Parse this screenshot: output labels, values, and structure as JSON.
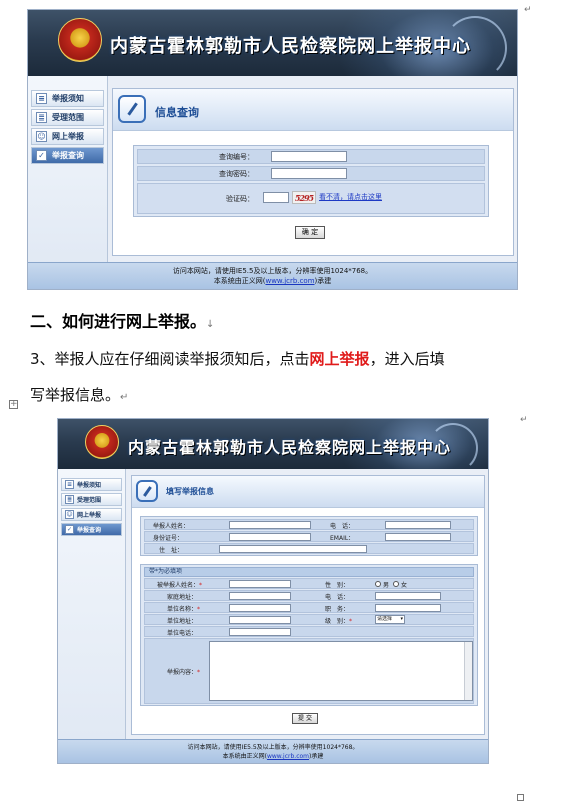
{
  "doc": {
    "section_heading": "二、如何进行网上举报。",
    "para_lead": "3、举报人应在仔细阅读举报须知后，点击",
    "para_highlight": "网上举报",
    "para_tail": "，进入后填",
    "para_line2": "写举报信息。",
    "return_mark": "↵",
    "down_mark": "↓"
  },
  "shot1": {
    "banner_title": "内蒙古霍林郭勒市人民检察院网上举报中心",
    "nav": [
      {
        "label": "举报须知",
        "icon": "document-icon",
        "glyph": "≡"
      },
      {
        "label": "受理范围",
        "icon": "list-icon",
        "glyph": "≣"
      },
      {
        "label": "网上举报",
        "icon": "person-card-icon",
        "glyph": "☺"
      },
      {
        "label": "举报查询",
        "icon": "checklist-icon",
        "glyph": "✓"
      }
    ],
    "panel_title": "信息查询",
    "fields": {
      "query_no_label": "查询编号：",
      "query_pwd_label": "查询密码：",
      "captcha_label": "验证码："
    },
    "captcha_text": "5295",
    "captcha_link": "看不清，请点击这里",
    "submit_label": "确 定",
    "footer_line1": "访问本网站，请使用IE5.5及以上版本，分辨率使用1024*768。",
    "footer_line2_pre": "本系统由正义网(",
    "footer_url": "www.jcrb.com",
    "footer_line2_post": ")承建"
  },
  "shot2": {
    "banner_title": "内蒙古霍林郭勒市人民检察院网上举报中心",
    "nav": [
      {
        "label": "举报须知",
        "icon": "document-icon",
        "glyph": "≡"
      },
      {
        "label": "受理范围",
        "icon": "list-icon",
        "glyph": "≣"
      },
      {
        "label": "网上举报",
        "icon": "person-card-icon",
        "glyph": "☺"
      },
      {
        "label": "举报查询",
        "icon": "checklist-icon",
        "glyph": "✓"
      }
    ],
    "panel_title": "填写举报信息",
    "reporter": {
      "name_label": "举报人姓名：",
      "phone_label": "电　话：",
      "id_label": "身份证号：",
      "email_label": "EMAIL：",
      "address_label": "住　址："
    },
    "fieldset_title": "带*为必填项",
    "reported": {
      "name_label": "被举报人姓名：",
      "gender_label": "性　别：",
      "gender_male": "男",
      "gender_female": "女",
      "home_addr_label": "家庭地址：",
      "phone_label": "电　话：",
      "unit_name_label": "单位名称：",
      "job_label": "职　务：",
      "unit_addr_label": "单位地址：",
      "level_label": "级　别：",
      "level_selected": "请选择",
      "unit_phone_label": "单位电话：",
      "content_label": "举报内容："
    },
    "required_mark": "*",
    "submit_label": "提 交",
    "footer_line1": "访问本网站，请使用IE5.5及以上版本，分辨率使用1024*768。",
    "footer_line2_pre": "本系统由正义网(",
    "footer_url": "www.jcrb.com",
    "footer_line2_post": ")承建"
  }
}
